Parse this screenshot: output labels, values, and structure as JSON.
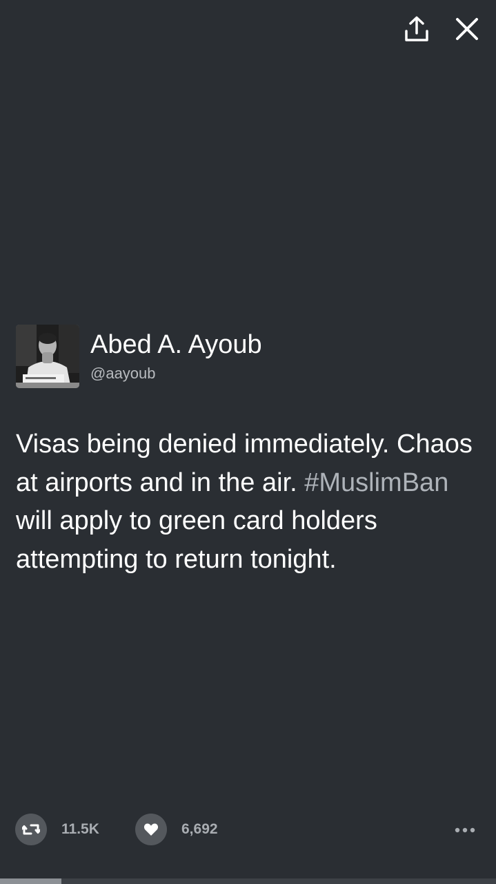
{
  "toolbar": {
    "share_icon": "share-upload-icon",
    "close_icon": "close-icon"
  },
  "tweet": {
    "author_name": "Abed A. Ayoub",
    "author_handle": "@aayoub",
    "text_before_hashtag": "Visas being denied immediately. Chaos at airports and in the air.",
    "hashtag": "#MuslimBan",
    "text_after_hashtag": " will apply to green card holders attempting to return tonight."
  },
  "actions": {
    "retweet_icon": "retweet-icon",
    "retweet_count": "11.5K",
    "like_icon": "heart-icon",
    "like_count": "6,692",
    "more_icon": "more-dots-icon"
  },
  "progress": {
    "fraction": 0.124
  },
  "colors": {
    "background": "#2a2e33",
    "text": "#ffffff",
    "hashtag": "#aeb3b9",
    "secondary": "#b8bbbf",
    "action_circle": "#54585d"
  }
}
